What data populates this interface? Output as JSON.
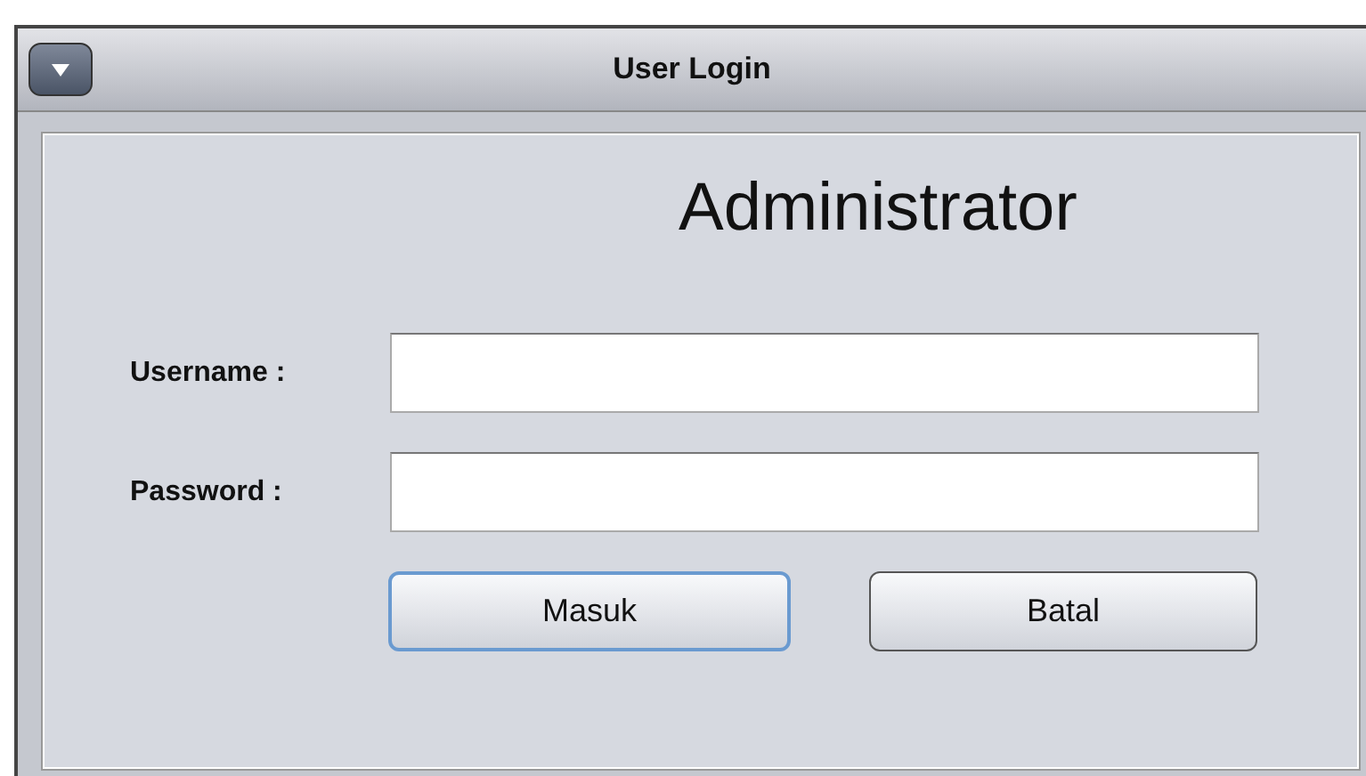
{
  "window": {
    "title": "User Login"
  },
  "heading": "Administrator",
  "fields": [
    {
      "label": "Username :"
    },
    {
      "label": "Password :"
    }
  ],
  "buttons": [
    {
      "label": "Masuk",
      "focused": true
    },
    {
      "label": "Batal",
      "focused": false
    }
  ]
}
